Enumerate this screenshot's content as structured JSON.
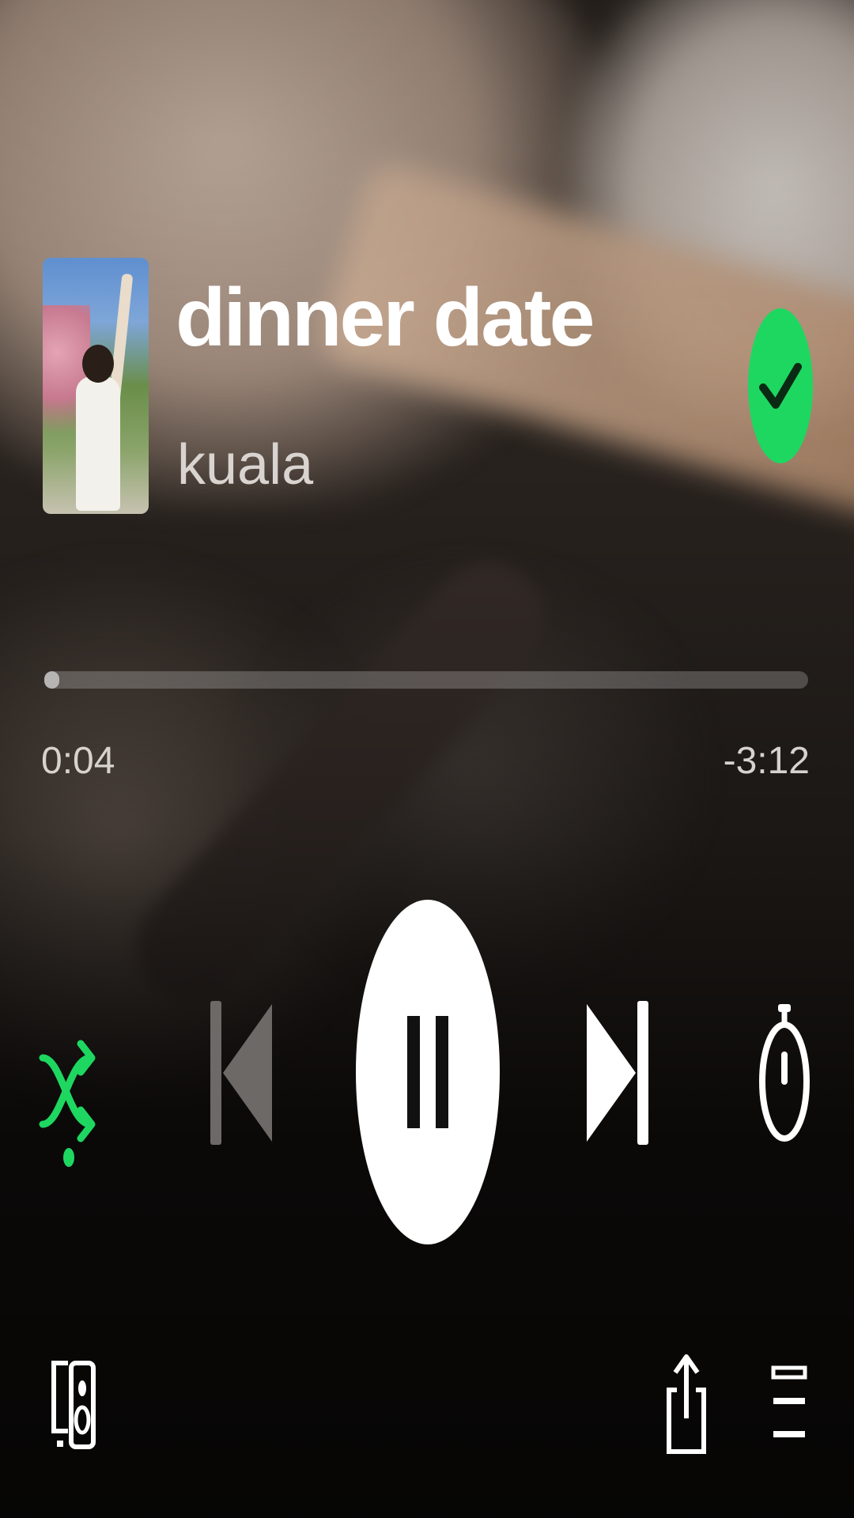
{
  "track": {
    "title": "dinner date",
    "artist": "kuala",
    "saved": true,
    "progress_fraction": 0.02
  },
  "times": {
    "elapsed": "0:04",
    "remaining": "-3:12"
  },
  "colors": {
    "accent": "#1ed760",
    "text": "#ffffff",
    "secondary_text": "#d9d4d0"
  },
  "icons": {
    "shuffle": "shuffle-icon",
    "previous": "skip-previous-icon",
    "pause": "pause-icon",
    "next": "skip-next-icon",
    "timer": "sleep-timer-icon",
    "devices": "connect-devices-icon",
    "share": "share-icon",
    "queue": "queue-icon",
    "saved": "check-icon"
  },
  "states": {
    "shuffle_active": true,
    "previous_disabled": true,
    "is_playing": true
  }
}
